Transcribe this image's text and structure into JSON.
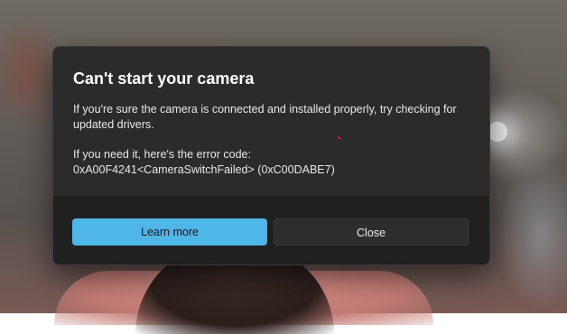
{
  "dialog": {
    "title": "Can't start your camera",
    "message": "If you're sure the camera is connected and installed properly, try checking for updated drivers.",
    "error_intro": "If you need it, here's the error code:",
    "error_code": "0xA00F4241<CameraSwitchFailed> (0xC00DABE7)",
    "buttons": {
      "learn_more": "Learn more",
      "close": "Close"
    }
  },
  "colors": {
    "dialog_bg": "#2b2b2b",
    "footer_bg": "#202020",
    "accent": "#4fb6e8",
    "secondary_button": "#2d2d2d"
  }
}
